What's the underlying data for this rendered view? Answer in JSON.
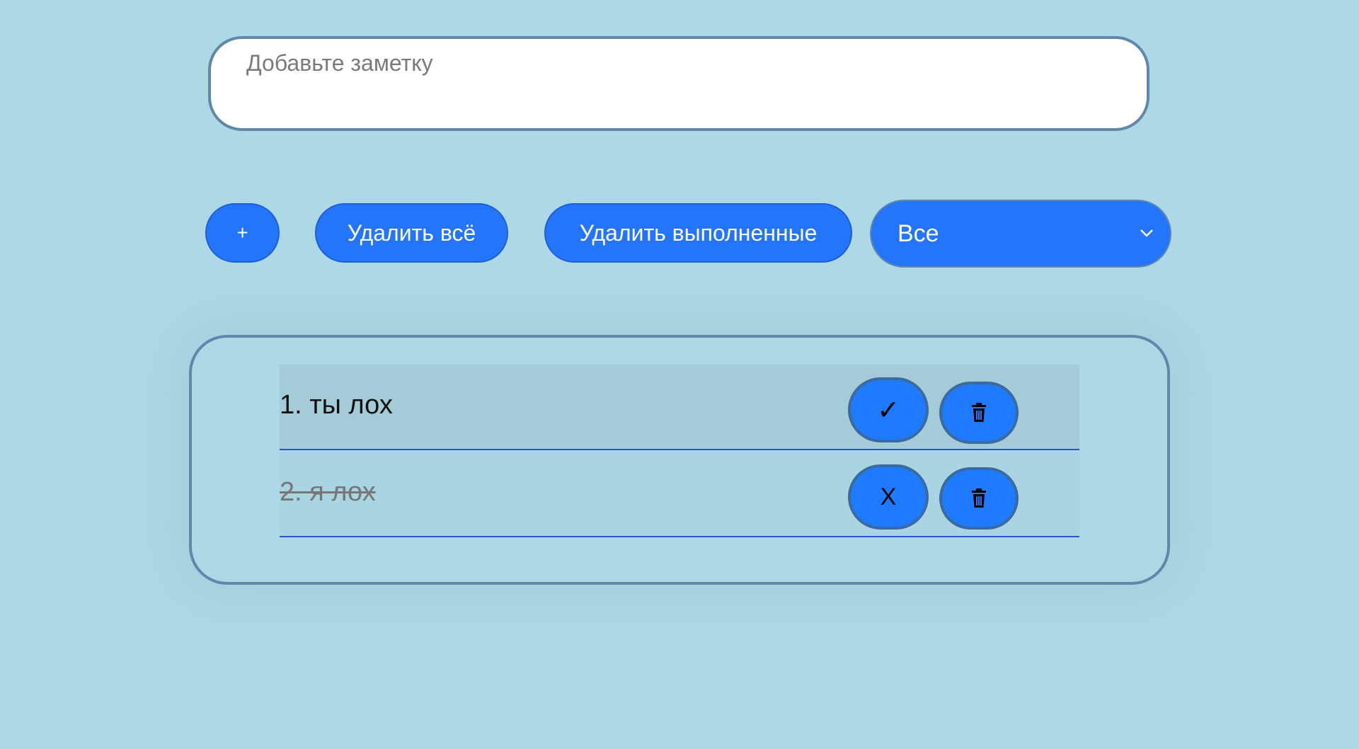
{
  "input": {
    "placeholder": "Добавьте заметку",
    "value": ""
  },
  "toolbar": {
    "add_label": "+",
    "delete_all_label": "Удалить всё",
    "delete_completed_label": "Удалить выполненные",
    "filter_selected": "Все"
  },
  "todos": [
    {
      "text": "1. ты лох",
      "completed": false,
      "toggle_symbol": "✓",
      "delete_icon": "trash-icon"
    },
    {
      "text": "2. я лох",
      "completed": true,
      "toggle_symbol": "X",
      "delete_icon": "trash-icon"
    }
  ],
  "colors": {
    "background": "#add8e6",
    "accent": "#2575fc",
    "border": "#5f88aa",
    "row_divider": "#2a52d4"
  },
  "icons": {
    "filter_dropdown": "chevron-down-icon",
    "delete": "trash-icon"
  }
}
